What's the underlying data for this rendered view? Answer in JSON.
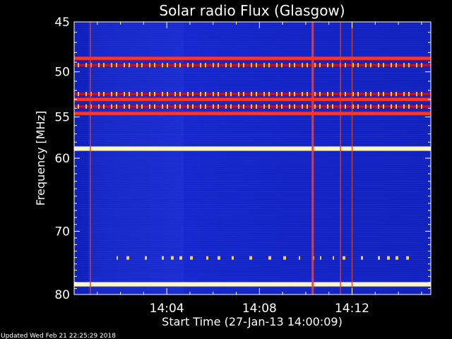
{
  "chart_data": {
    "type": "heatmap",
    "title": "Solar radio Flux (Glasgow)",
    "xlabel": "Start Time (27-Jan-13 14:00:09)",
    "ylabel": "Frequency [MHz]",
    "x_range_minutes": [
      14.0,
      29.4
    ],
    "x_ticks": [
      {
        "label": "14:04",
        "value": 18.0
      },
      {
        "label": "14:08",
        "value": 22.0
      },
      {
        "label": "14:12",
        "value": 26.0
      }
    ],
    "y_scale": "log",
    "y_range": [
      45,
      80
    ],
    "y_ticks": [
      45,
      50,
      55,
      60,
      70,
      80
    ],
    "background_color": "#1326c8",
    "colormap": [
      "#000020",
      "#1326c8",
      "#c8102e",
      "#ff3a1e",
      "#ffd040",
      "#fff7c8"
    ],
    "interference_bands_mhz": [
      {
        "freq": 48.6,
        "level": "high"
      },
      {
        "freq": 49.3,
        "level": "medium"
      },
      {
        "freq": 52.4,
        "level": "medium"
      },
      {
        "freq": 53.0,
        "level": "high"
      },
      {
        "freq": 53.8,
        "level": "medium"
      },
      {
        "freq": 54.6,
        "level": "high"
      },
      {
        "freq": 58.8,
        "level": "very-high"
      },
      {
        "freq": 74.0,
        "level": "sporadic"
      },
      {
        "freq": 78.3,
        "level": "very-high"
      }
    ],
    "vertical_features_minutes": [
      {
        "t": 14.7,
        "level": "medium"
      },
      {
        "t": 24.3,
        "level": "high"
      },
      {
        "t": 25.5,
        "level": "medium"
      },
      {
        "t": 26.0,
        "level": "medium"
      }
    ]
  },
  "footer": {
    "updated": "Updated Wed Feb 21 22:25:29 2018"
  }
}
